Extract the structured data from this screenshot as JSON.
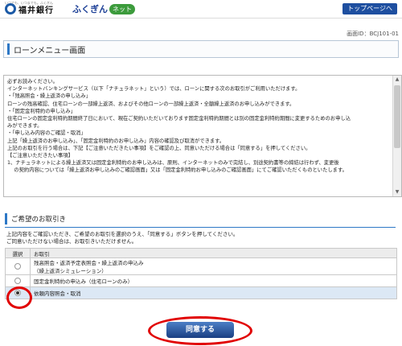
{
  "header": {
    "bank_tagline": "いつでも、いつまでも。ふくぎん",
    "bank_name": "福井銀行",
    "brand_name": "ふくぎん",
    "brand_net": "ネット",
    "top_page_button": "トップページへ"
  },
  "screen_id": "画面ID：BCJ101-01",
  "page_title": "ローンメニュー画面",
  "notice_lines": [
    "必ずお読みください。",
    "",
    "インターネットバンキングサービス（以下「ナチュラネット」という）では、ローンに関する次のお取引がご利用いただけます。",
    "・「残高照会・繰上返済の申し込み」",
    "ローンの残高確認、住宅ローンの一部繰上返済、およびその他ローンの一部繰上返済・全額繰上返済のお申し込みができます。",
    "・「固定金利特約の申し込み」",
    "住宅ローンの固定金利特約期間終了日において、現在ご契約いただいております固定金利特約期間とは別の固定金利特約期間に変更するためのお申し込",
    "みができます。",
    "・「申し込み内容のご確認・取消」",
    "上記「繰上返済のお申し込み」、「固定金利特約のお申し込み」内容の確認及び取消ができます。",
    "上記のお取引を行う場合は、下記【ご注意いただきたい事項】をご確認の上、同意いただける場合は「同意する」を押してください。",
    "",
    "【ご注意いただきたい事項】",
    "1、ナチュラネットによる繰上返済又は固定金利特約のお申し込みは、原則、インターネットのみで完結し、別途契約書等の締結は行わず、変更後",
    "　 の契約内容については「繰上返済お申し込みのご確認画面」又は「固定金利特約お申し込みのご確認画面」にてご確認いただくものといたします。"
  ],
  "section_title": "ご希望のお取引き",
  "instructions": [
    "上記内容をご確認いただき、ご希望のお取引を選択のうえ、「同意する」ボタンを押してください。",
    "ご同意いただけない場合は、お取引きいただけません。"
  ],
  "table": {
    "headers": [
      "選択",
      "お取引"
    ],
    "rows": [
      {
        "label": "残高照会・返済予定表照会・繰上返済の申込み",
        "sublabel": "（繰上返済シミュレーション）",
        "selected": false
      },
      {
        "label": "固定金利特約の申込み（住宅ローンのみ）",
        "sublabel": "",
        "selected": false
      },
      {
        "label": "依頼内容照会・取消",
        "sublabel": "",
        "selected": true
      }
    ]
  },
  "agree_button": "同意する",
  "colors": {
    "accent": "#2d78c6",
    "highlight_circle": "#e10000",
    "button": "#1e4fa0"
  }
}
